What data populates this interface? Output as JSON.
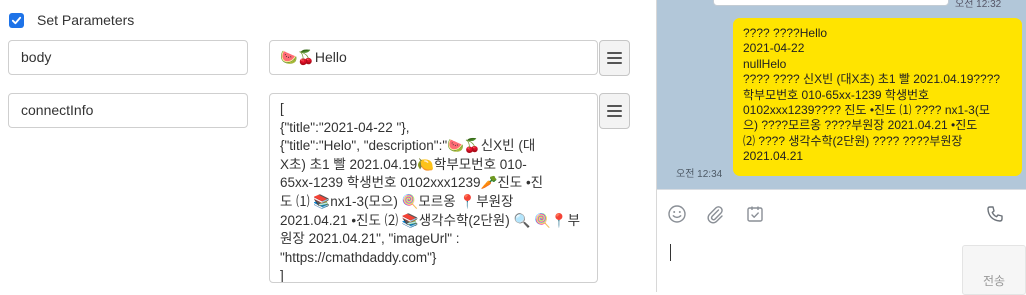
{
  "params": {
    "checkbox_checked": true,
    "label": "Set Parameters"
  },
  "rows": [
    {
      "key": "body",
      "value": "🍉🍒Hello"
    },
    {
      "key": "connectInfo",
      "value": "[\n{\"title\":\"2021-04-22 \"},\n{\"title\":\"Helo\", \"description\":\"🍉🍒신X빈 (대\nX초) 초1 빨 2021.04.19🍋학부모번호 010-\n65xx-1239 학생번호 0102xxx1239🥕진도 •진\n도 ⑴ 📚nx1-3(모으) 🍭모르옹 📍부원장\n2021.04.21 •진도 ⑵ 📚생각수학(2단원) 🔍 🍭📍부\n원장 2021.04.21\", \"imageUrl\" :\n\"https://cmathdaddy.com\"}\n]"
    }
  ],
  "icons": {
    "menu": "hamburger-icon",
    "emoji": "smiley-icon",
    "attach": "paperclip-icon",
    "schedule": "calendar-check-icon",
    "call": "phone-icon"
  },
  "chat": {
    "prev_time": "오전 12:32",
    "message": "???? ????Hello\n2021-04-22\nnullHelo\n???? ???? 신X빈 (대X초) 초1 빨 2021.04.19????\n학부모번호 010-65xx-1239 학생번호\n0102xxx1239???? 진도 •진도 ⑴ ???? nx1-3(모\n으) ????모르옹 ????부원장 2021.04.21 •진도\n⑵ ???? 생각수학(2단원) ???? ????부원장\n2021.04.21",
    "time": "오전 12:34",
    "input_value": "",
    "send_label": "전송"
  },
  "colors": {
    "accent": "#1e73e8",
    "chat_background": "#b2c7d9",
    "bubble": "#ffe400"
  }
}
